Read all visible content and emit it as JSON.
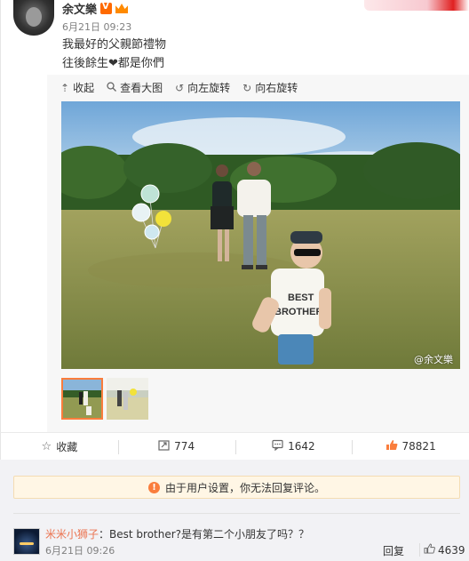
{
  "post": {
    "username": "余文樂",
    "time": "6月21日 09:23",
    "text_line1": "我最好的父親節禮物",
    "text_line2": "往後餘生❤都是你們"
  },
  "media_toolbar": {
    "collapse": "收起",
    "view_large": "查看大图",
    "rotate_left": "向左旋转",
    "rotate_right": "向右旋转"
  },
  "photo": {
    "watermark": "@余文樂",
    "shirt_text_line1": "BEST",
    "shirt_text_line2": "BROTHER"
  },
  "actions": {
    "favorite": "收藏",
    "reposts": "774",
    "comments": "1642",
    "likes": "78821"
  },
  "notice": {
    "text": "由于用户设置，你无法回复评论。"
  },
  "comment": {
    "user": "米米小狮子",
    "separator": "：",
    "text": "Best brother?是有第二个小朋友了吗？？",
    "time": "6月21日 09:26",
    "reply": "回复",
    "likes": "4639"
  },
  "colors": {
    "accent": "#fa7d3c",
    "comment_user": "#eb7350",
    "notice_bg": "#fff6e5"
  }
}
